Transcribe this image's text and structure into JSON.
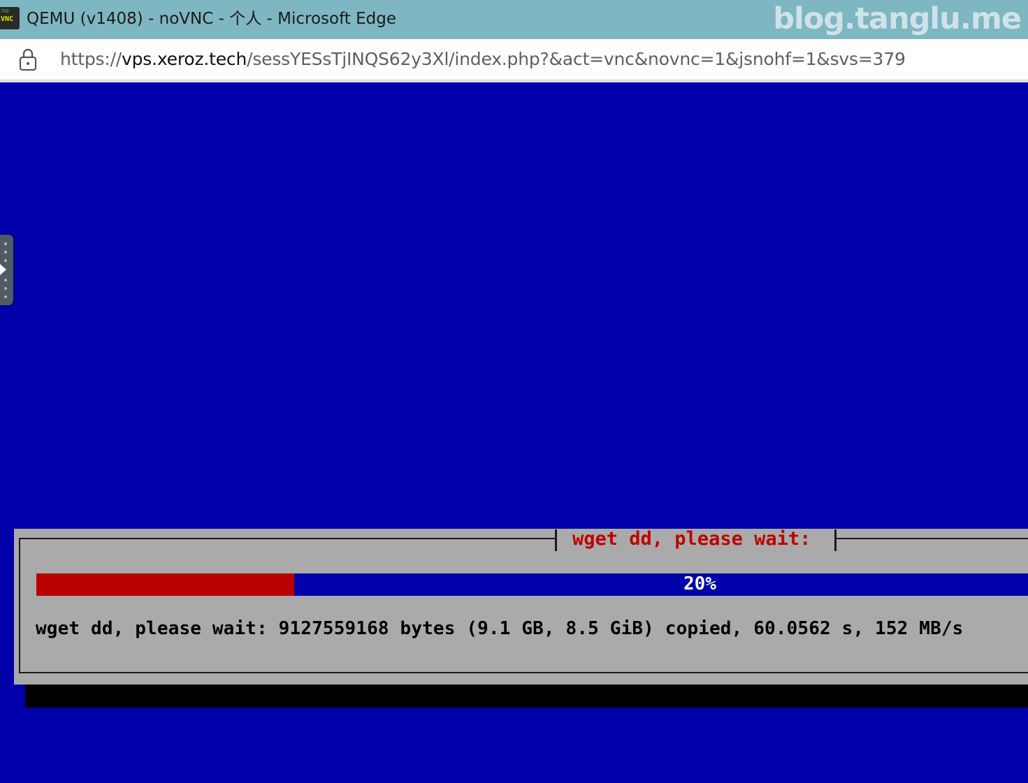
{
  "window": {
    "title": "QEMU (v1408) - noVNC - 个人 - Microsoft Edge",
    "icon_text_top": "no",
    "icon_text_bottom": "VNC",
    "icon": "novnc-app-icon"
  },
  "watermark": {
    "text": "blog.tanglu.me"
  },
  "addressbar": {
    "icon": "lock-icon",
    "url_prefix": "https://",
    "url_host": "vps.xeroz.tech",
    "url_path": "/sessYESsTjINQS62y3Xl/index.php?&act=vnc&novnc=1&jsnohf=1&svs=379"
  },
  "novnc": {
    "control_bar_icon": "expand-arrow-icon"
  },
  "dialog": {
    "title": "wget dd, please wait:",
    "progress_label": "20%",
    "progress_fraction": 0.26,
    "status_text": "wget dd, please wait: 9127559168 bytes (9.1 GB, 8.5 GiB) copied, 60.0562 s, 152 MB/s"
  },
  "colors": {
    "title_bar": "#7eb6c2",
    "console_background": "#0000aa",
    "dialog_background": "#aaaaaa",
    "dialog_title": "#c00000",
    "progress_fill": "#bb0000",
    "progress_track": "#0000aa"
  }
}
